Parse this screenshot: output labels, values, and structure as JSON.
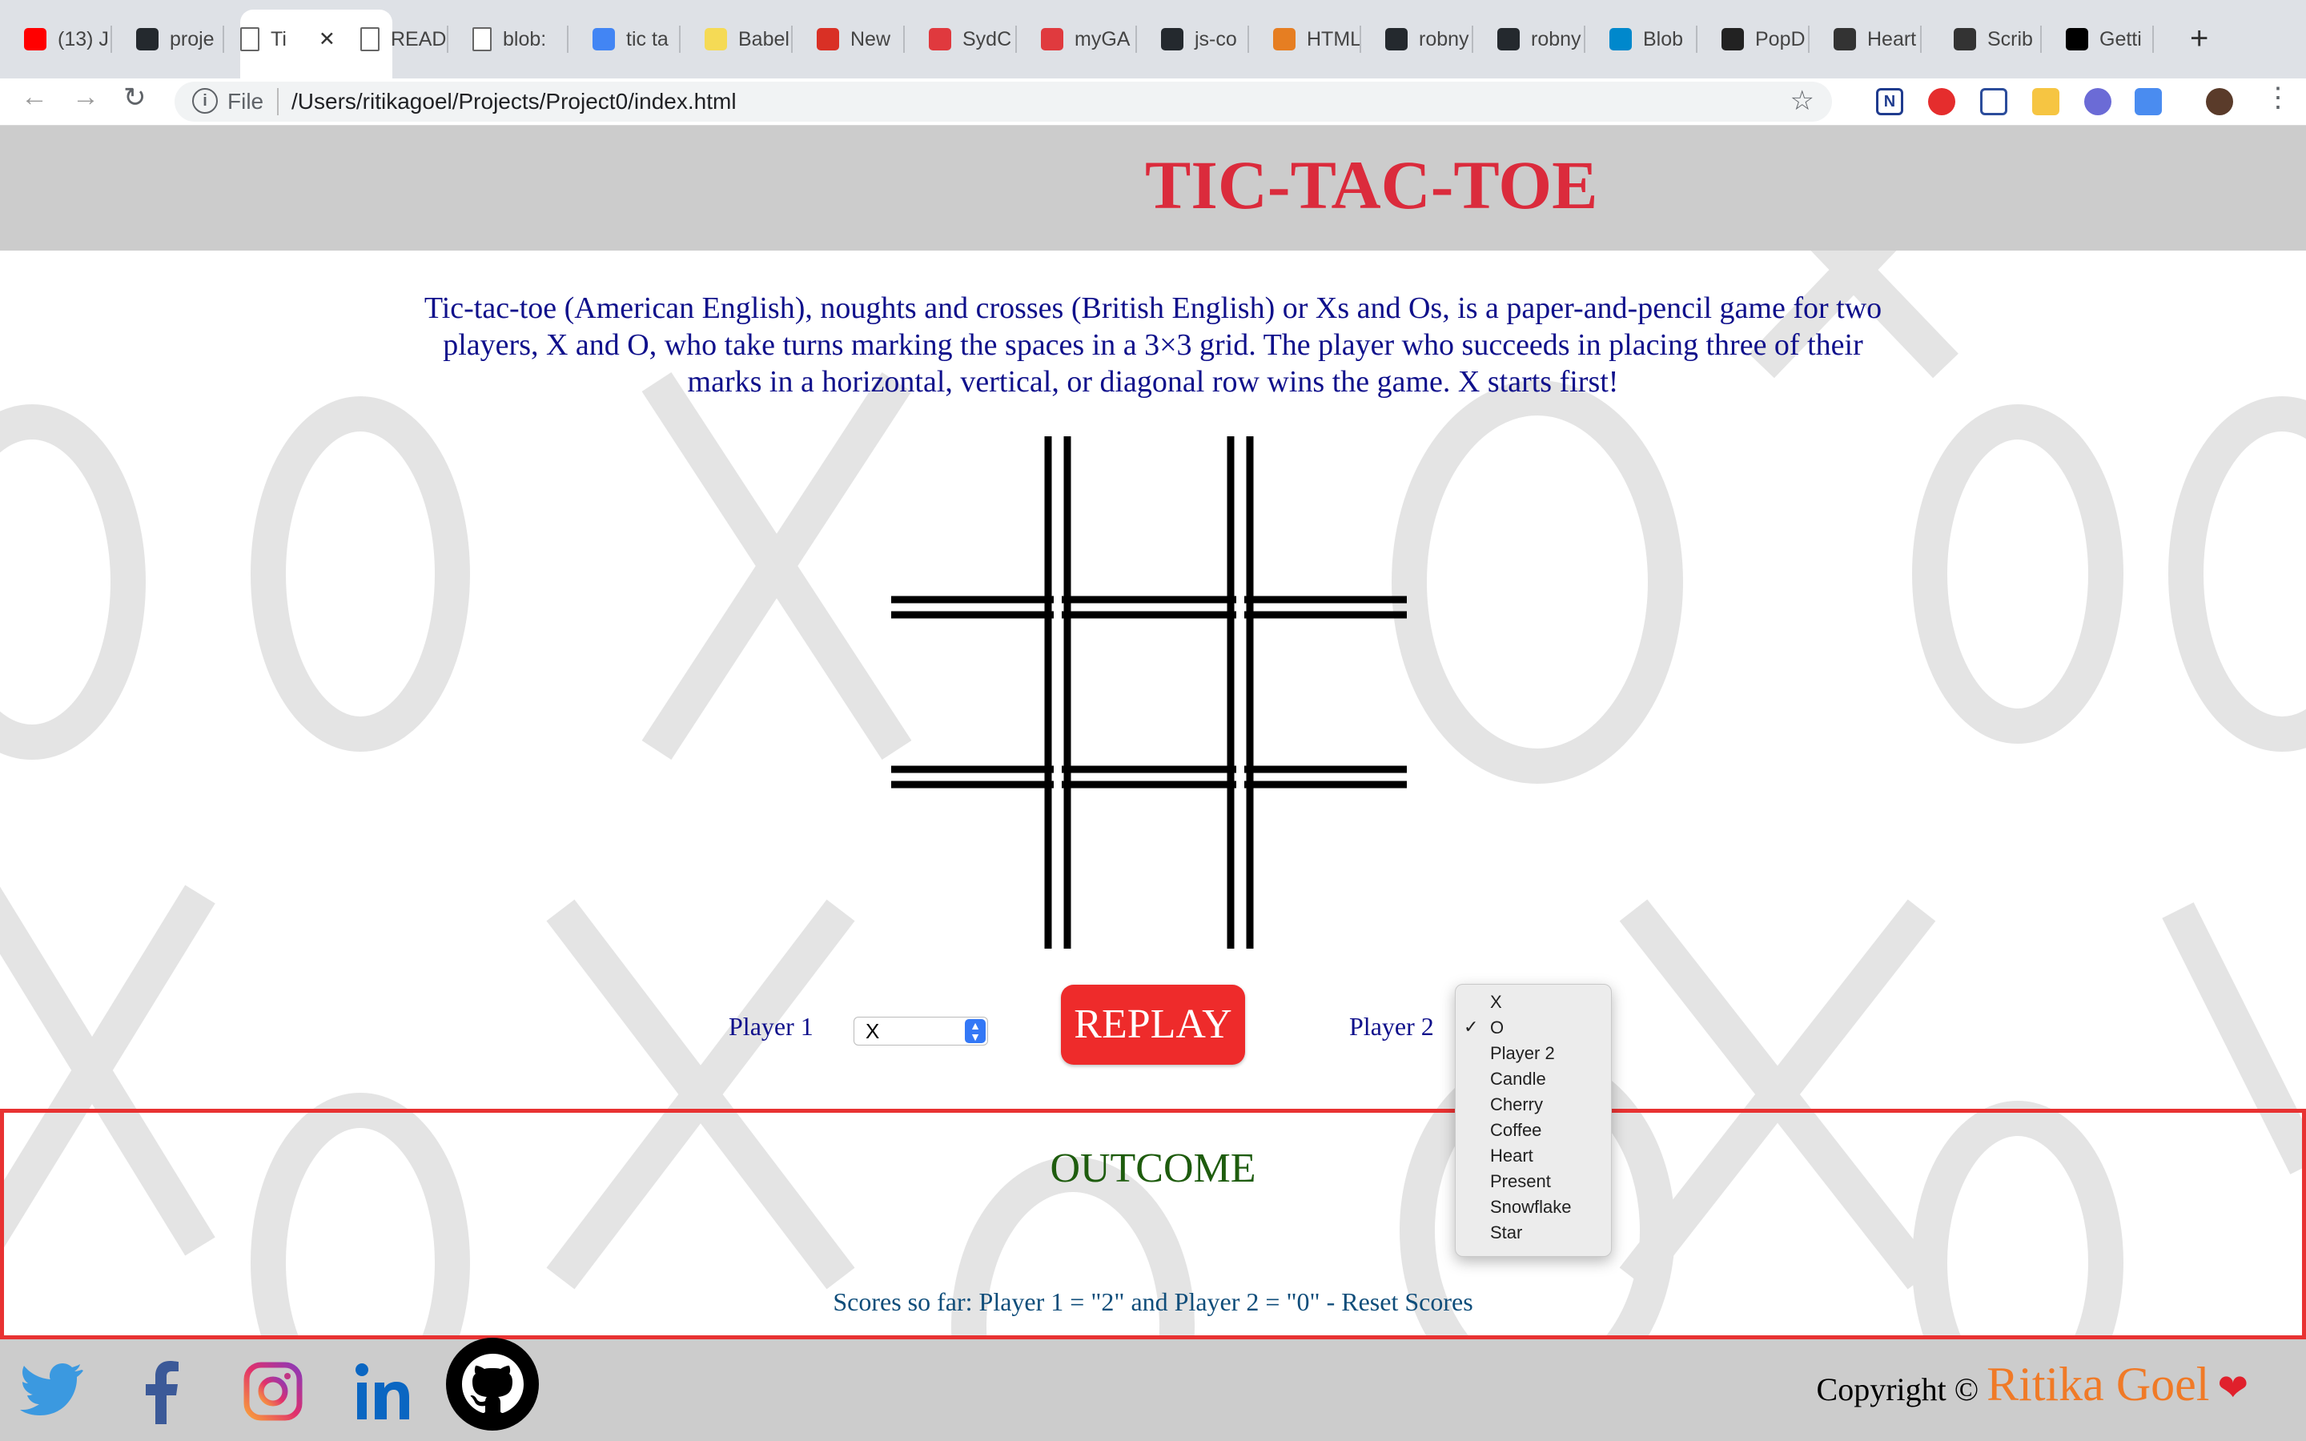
{
  "browser": {
    "tabs": [
      {
        "label": "(13) J",
        "icon": "youtube-icon",
        "color": "#ff0000"
      },
      {
        "label": "proje",
        "icon": "github-icon",
        "color": "#24292e"
      },
      {
        "label": "Ti",
        "icon": "page-icon",
        "color": "#ffffff",
        "active": true
      },
      {
        "label": "READ",
        "icon": "page-icon",
        "color": "#ffffff"
      },
      {
        "label": "blob:",
        "icon": "page-icon",
        "color": "#ffffff"
      },
      {
        "label": "tic ta",
        "icon": "google-icon",
        "color": "#4285f4"
      },
      {
        "label": "Babel",
        "icon": "babel-icon",
        "color": "#f5da55"
      },
      {
        "label": "New",
        "icon": "gmail-icon",
        "color": "#d93025"
      },
      {
        "label": "SydC",
        "icon": "meetup-icon",
        "color": "#e0393e"
      },
      {
        "label": "myGA",
        "icon": "ga-icon",
        "color": "#e03a3e"
      },
      {
        "label": "js-co",
        "icon": "github-icon",
        "color": "#24292e"
      },
      {
        "label": "HTML",
        "icon": "html-icon",
        "color": "#e67e22"
      },
      {
        "label": "robny",
        "icon": "github-icon",
        "color": "#24292e"
      },
      {
        "label": "robny",
        "icon": "github-icon",
        "color": "#24292e"
      },
      {
        "label": "Blob",
        "icon": "blob-icon",
        "color": "#0088cc"
      },
      {
        "label": "PopD",
        "icon": "popd-icon",
        "color": "#222222"
      },
      {
        "label": "Heart",
        "icon": "scribd-icon",
        "color": "#333333"
      },
      {
        "label": "Scrib",
        "icon": "scribd-icon",
        "color": "#333333"
      },
      {
        "label": "Getti",
        "icon": "medium-icon",
        "color": "#000000"
      }
    ],
    "close_tab": "✕",
    "new_tab": "+",
    "omnibox": {
      "scheme_label": "File",
      "url": "/Users/ritikagoel/Projects/Project0/index.html"
    }
  },
  "page": {
    "title": "TIC-TAC-TOE",
    "description": "Tic-tac-toe (American English), noughts and crosses (British English) or Xs and Os, is a paper-and-pencil game for two players, X and O, who take turns marking the spaces in a 3×3 grid. The player who succeeds in placing three of their marks in a horizontal, vertical, or diagonal row wins the game. X starts first!",
    "player1_label": "Player 1",
    "player1_value": "X",
    "player2_label": "Player 2",
    "replay_label": "REPLAY",
    "outcome_title": "OUTCOME",
    "scores_text": "Scores so far: Player 1 = \"2\" and Player 2 = \"0\" - Reset Scores",
    "copyright_prefix": "Copyright ©",
    "copyright_name": "Ritika Goel",
    "heart": "❤",
    "social": [
      "twitter-icon",
      "facebook-icon",
      "instagram-icon",
      "linkedin-icon",
      "github-icon"
    ]
  },
  "dropdown": {
    "selected": "O",
    "check": "✓",
    "options": [
      "X",
      "O",
      "Player 2",
      "Candle",
      "Cherry",
      "Coffee",
      "Heart",
      "Present",
      "Snowflake",
      "Star"
    ]
  },
  "colors": {
    "title": "#db2b3c",
    "text": "#0f108b",
    "replay": "#ee2b2b",
    "outcome_border": "#e83232",
    "outcome_title": "#1e5c0e",
    "header_bg": "#cccccc"
  }
}
